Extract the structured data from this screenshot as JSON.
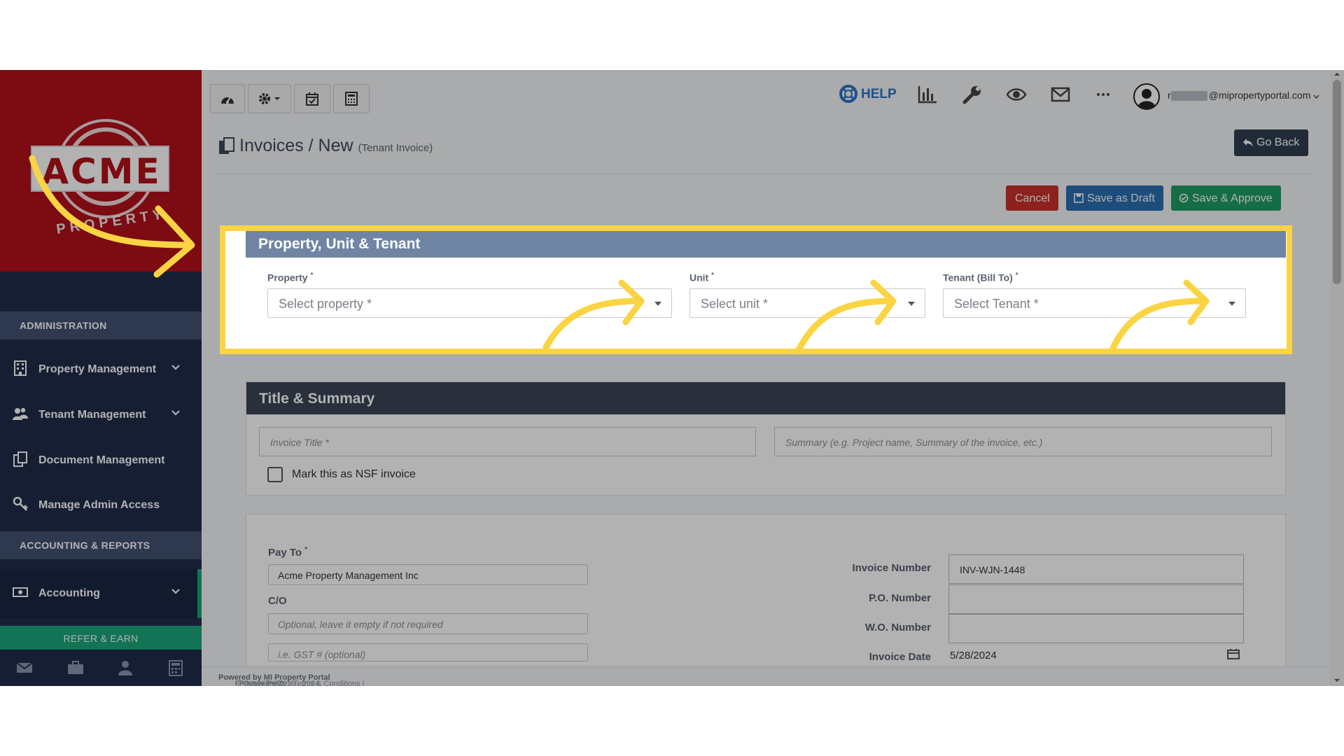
{
  "sidebar": {
    "logo": {
      "name": "ACME",
      "sub": "PROPERTY"
    },
    "sections": [
      {
        "label": "ADMINISTRATION"
      },
      {
        "label": "ACCOUNTING & REPORTS"
      }
    ],
    "items": [
      {
        "label": "Property Management",
        "icon": "building-icon",
        "has_chevron": true
      },
      {
        "label": "Tenant Management",
        "icon": "users-icon",
        "has_chevron": true
      },
      {
        "label": "Document Management",
        "icon": "documents-icon",
        "has_chevron": false
      },
      {
        "label": "Manage Admin Access",
        "icon": "key-icon",
        "has_chevron": false
      },
      {
        "label": "Accounting",
        "icon": "money-icon",
        "has_chevron": true
      }
    ],
    "refer_label": "REFER & EARN",
    "footer_icons": [
      "mail-icon",
      "briefcase-icon",
      "user-icon",
      "calculator-icon"
    ]
  },
  "topbar": {
    "buttons": [
      "dashboard-icon",
      "gear-icon",
      "calendar-check-icon",
      "calculator-icon"
    ],
    "help_label": "HELP",
    "icons": [
      "bar-chart-icon",
      "wrench-icon",
      "eye-icon",
      "envelope-icon",
      "more-icon"
    ],
    "email_visible": "@mipropertyportal.com",
    "email_prefix": "r"
  },
  "page": {
    "title": "Invoices / New",
    "subtitle": "(Tenant Invoice)",
    "go_back_label": "Go Back"
  },
  "actions": {
    "cancel": "Cancel",
    "save_draft": "Save as Draft",
    "save_approve": "Save & Approve"
  },
  "property_card": {
    "title": "Property, Unit & Tenant",
    "property_label": "Property",
    "property_placeholder": "Select property *",
    "unit_label": "Unit",
    "unit_placeholder": "Select unit *",
    "tenant_label": "Tenant (Bill To)",
    "tenant_placeholder": "Select Tenant *",
    "required_mark": "*"
  },
  "title_card": {
    "title": "Title & Summary",
    "invoice_title_placeholder": "Invoice Title *",
    "summary_placeholder": "Summary (e.g. Project name, Summary of the invoice, etc.)",
    "nsf_label": "Mark this as NSF invoice"
  },
  "details_card": {
    "pay_to_label": "Pay To",
    "pay_to_value": "Acme Property Management Inc",
    "co_label": "C/O",
    "co_placeholder": "Optional, leave it empty if not required",
    "gst_placeholder": "i.e. GST # (optional)",
    "invoice_number_label": "Invoice Number",
    "invoice_number_value": "INV-WJN-1448",
    "po_label": "P.O. Number",
    "wo_label": "W.O. Number",
    "invoice_date_label": "Invoice Date",
    "invoice_date_value": "5/28/2024"
  },
  "footer": {
    "copyright": "© Copyright 2016 - 2024",
    "powered": "Powered by MI Property Portal",
    "links": "| Privacy Policy | Terms & Conditions |",
    "version": "(Tenants by Dewitt)"
  },
  "colors": {
    "highlight": "#fbd444",
    "sidebar_bg": "#1f2c4a",
    "logo_bg": "#b3111b",
    "cancel": "#c9302c",
    "draft": "#2a6fb0",
    "approve": "#1f9d63",
    "card_head_property": "#6f85a3",
    "card_head_title": "#3b4656"
  }
}
